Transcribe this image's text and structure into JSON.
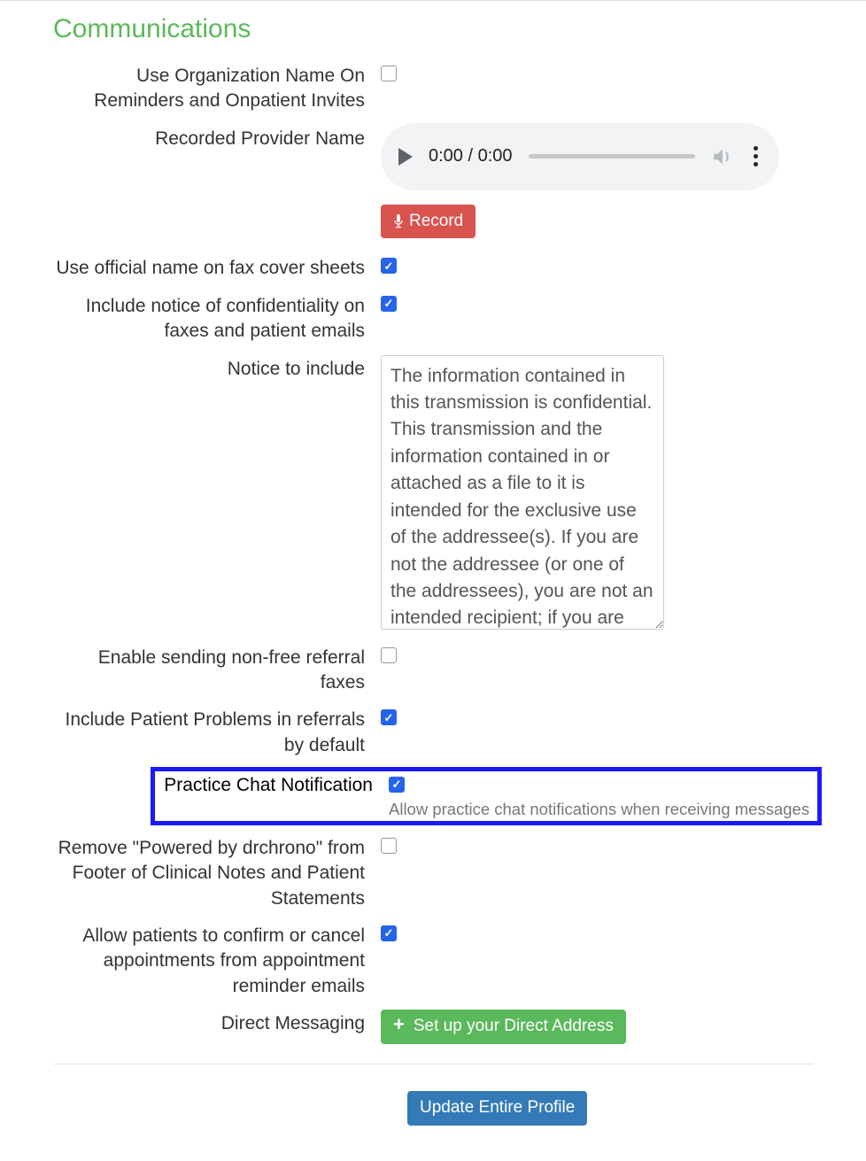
{
  "section_title": "Communications",
  "fields": {
    "org_name_label": "Use Organization Name On Reminders and Onpatient Invites",
    "recorded_label": "Recorded Provider Name",
    "audio_time": "0:00 / 0:00",
    "record_btn": "Record",
    "fax_cover_label": "Use official name on fax cover sheets",
    "confidentiality_label": "Include notice of confidentiality on faxes and patient emails",
    "notice_label": "Notice to include",
    "notice_text": "The information contained in this transmission is confidential. This transmission and the information contained in or attached as a file to it is intended for the exclusive use of the addressee(s). If you are not the addressee (or one of the addressees), you are not an intended recipient; if you are not an intended recipient, you",
    "nonfree_fax_label": "Enable sending non-free referral faxes",
    "patient_problems_label": "Include Patient Problems in referrals by default",
    "chat_notif_label": "Practice Chat Notification",
    "chat_notif_help": "Allow practice chat notifications when receiving messages",
    "remove_powered_label": "Remove \"Powered by drchrono\" from Footer of Clinical Notes and Patient Statements",
    "allow_confirm_label": "Allow patients to confirm or cancel appointments from appointment reminder emails",
    "direct_msg_label": "Direct Messaging",
    "direct_btn": "Set up your Direct Address",
    "update_btn": "Update Entire Profile"
  }
}
